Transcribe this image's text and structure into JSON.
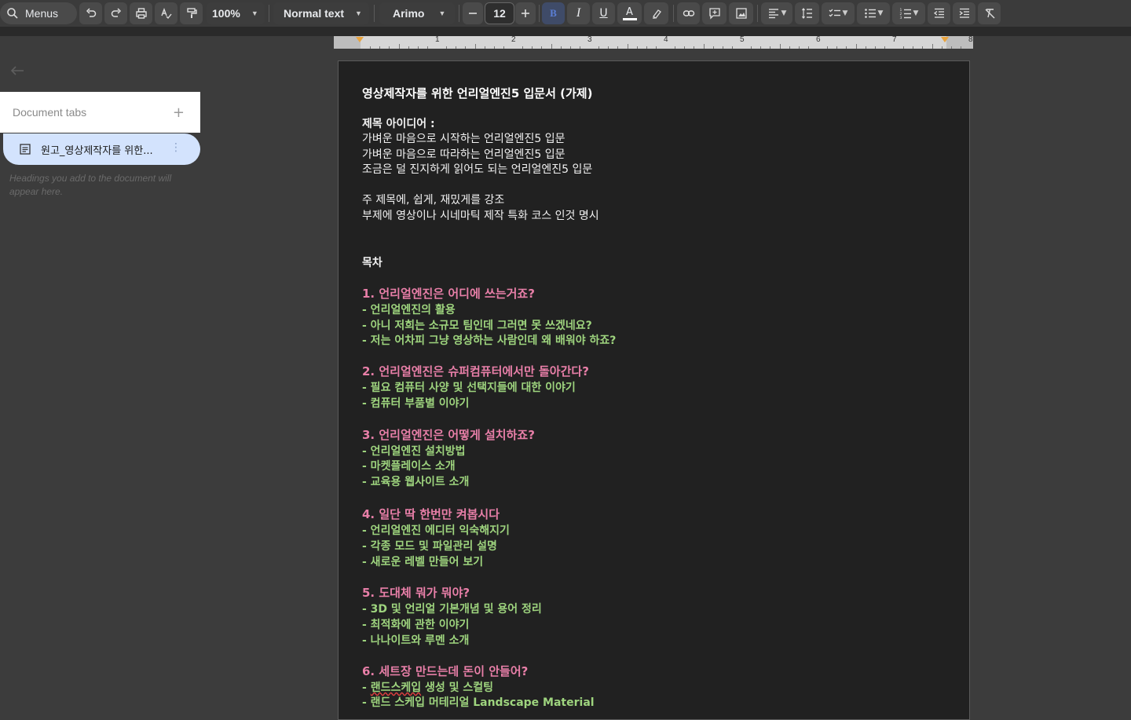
{
  "toolbar": {
    "menus_label": "Menus",
    "zoom": "100%",
    "style": "Normal text",
    "font": "Arimo",
    "font_size": "12",
    "bold_label": "B",
    "italic_label": "I",
    "underline_label": "U",
    "text_color_label": "A"
  },
  "ruler": {
    "numbers": [
      "1",
      "2",
      "3",
      "4",
      "5",
      "6",
      "7",
      "8"
    ]
  },
  "side_panel": {
    "header": "Document tabs",
    "add_label": "+",
    "tab_label": "원고_영상제작자를 위한...",
    "hint": "Headings you add to the document will appear here."
  },
  "document": {
    "title": "영상제작자를 위한 언리얼엔진5 입문서 (가제)",
    "idea_heading": "제목 아이디어 :",
    "ideas": [
      "가벼운 마음으로 시작하는 언리얼엔진5 입문",
      "가벼운 마음으로 따라하는 언리얼엔진5 입문",
      "조금은 덜 진지하게 읽어도 되는 언리얼엔진5 입문"
    ],
    "notes": [
      "주 제목에, 쉽게, 재밌게를 강조",
      "부제에 영상이나 시네마틱 제작 특화 코스 인것 명시"
    ],
    "toc_heading": "목차",
    "sections": [
      {
        "title": "1. 언리얼엔진은 어디에 쓰는거죠?",
        "items": [
          "- 언리얼엔진의 활용",
          "- 아니 저희는 소규모 팀인데 그러면 못 쓰겠네요?",
          "- 저는 어차피 그냥 영상하는 사람인데 왜 배워야 하죠?"
        ]
      },
      {
        "title": "2. 언리얼엔진은 슈퍼컴퓨터에서만 돌아간다?",
        "items": [
          "- 필요 컴퓨터 사양 및 선택지들에 대한 이야기",
          "- 컴퓨터 부품별 이야기"
        ]
      },
      {
        "title": "3. 언리얼엔진은 어떻게 설치하죠?",
        "items": [
          "- 언리얼엔진 설치방법",
          "- 마켓플레이스 소개",
          "- 교육용 웹사이트 소개"
        ]
      },
      {
        "title": "4. 일단 딱 한번만 켜봅시다",
        "items": [
          "- 언리얼엔진 에디터 익숙해지기",
          "- 각종 모드 및 파일관리 설명",
          "- 새로운 레벨 만들어 보기"
        ]
      },
      {
        "title": "5. 도대체 뭐가 뭐야?",
        "items": [
          "- 3D 및 언리얼 기본개념 및 용어 정리",
          "- 최적화에 관한 이야기",
          "- 나나이트와 루멘 소개"
        ]
      },
      {
        "title": "6. 세트장 만드는데 돈이 안들어?",
        "items_pre": "- ",
        "items_spell": "랜드스케입",
        "items_post": " 생성 및 스컬팅",
        "item_last": "- 랜드 스케입 머테리얼 Landscape Material"
      }
    ]
  }
}
